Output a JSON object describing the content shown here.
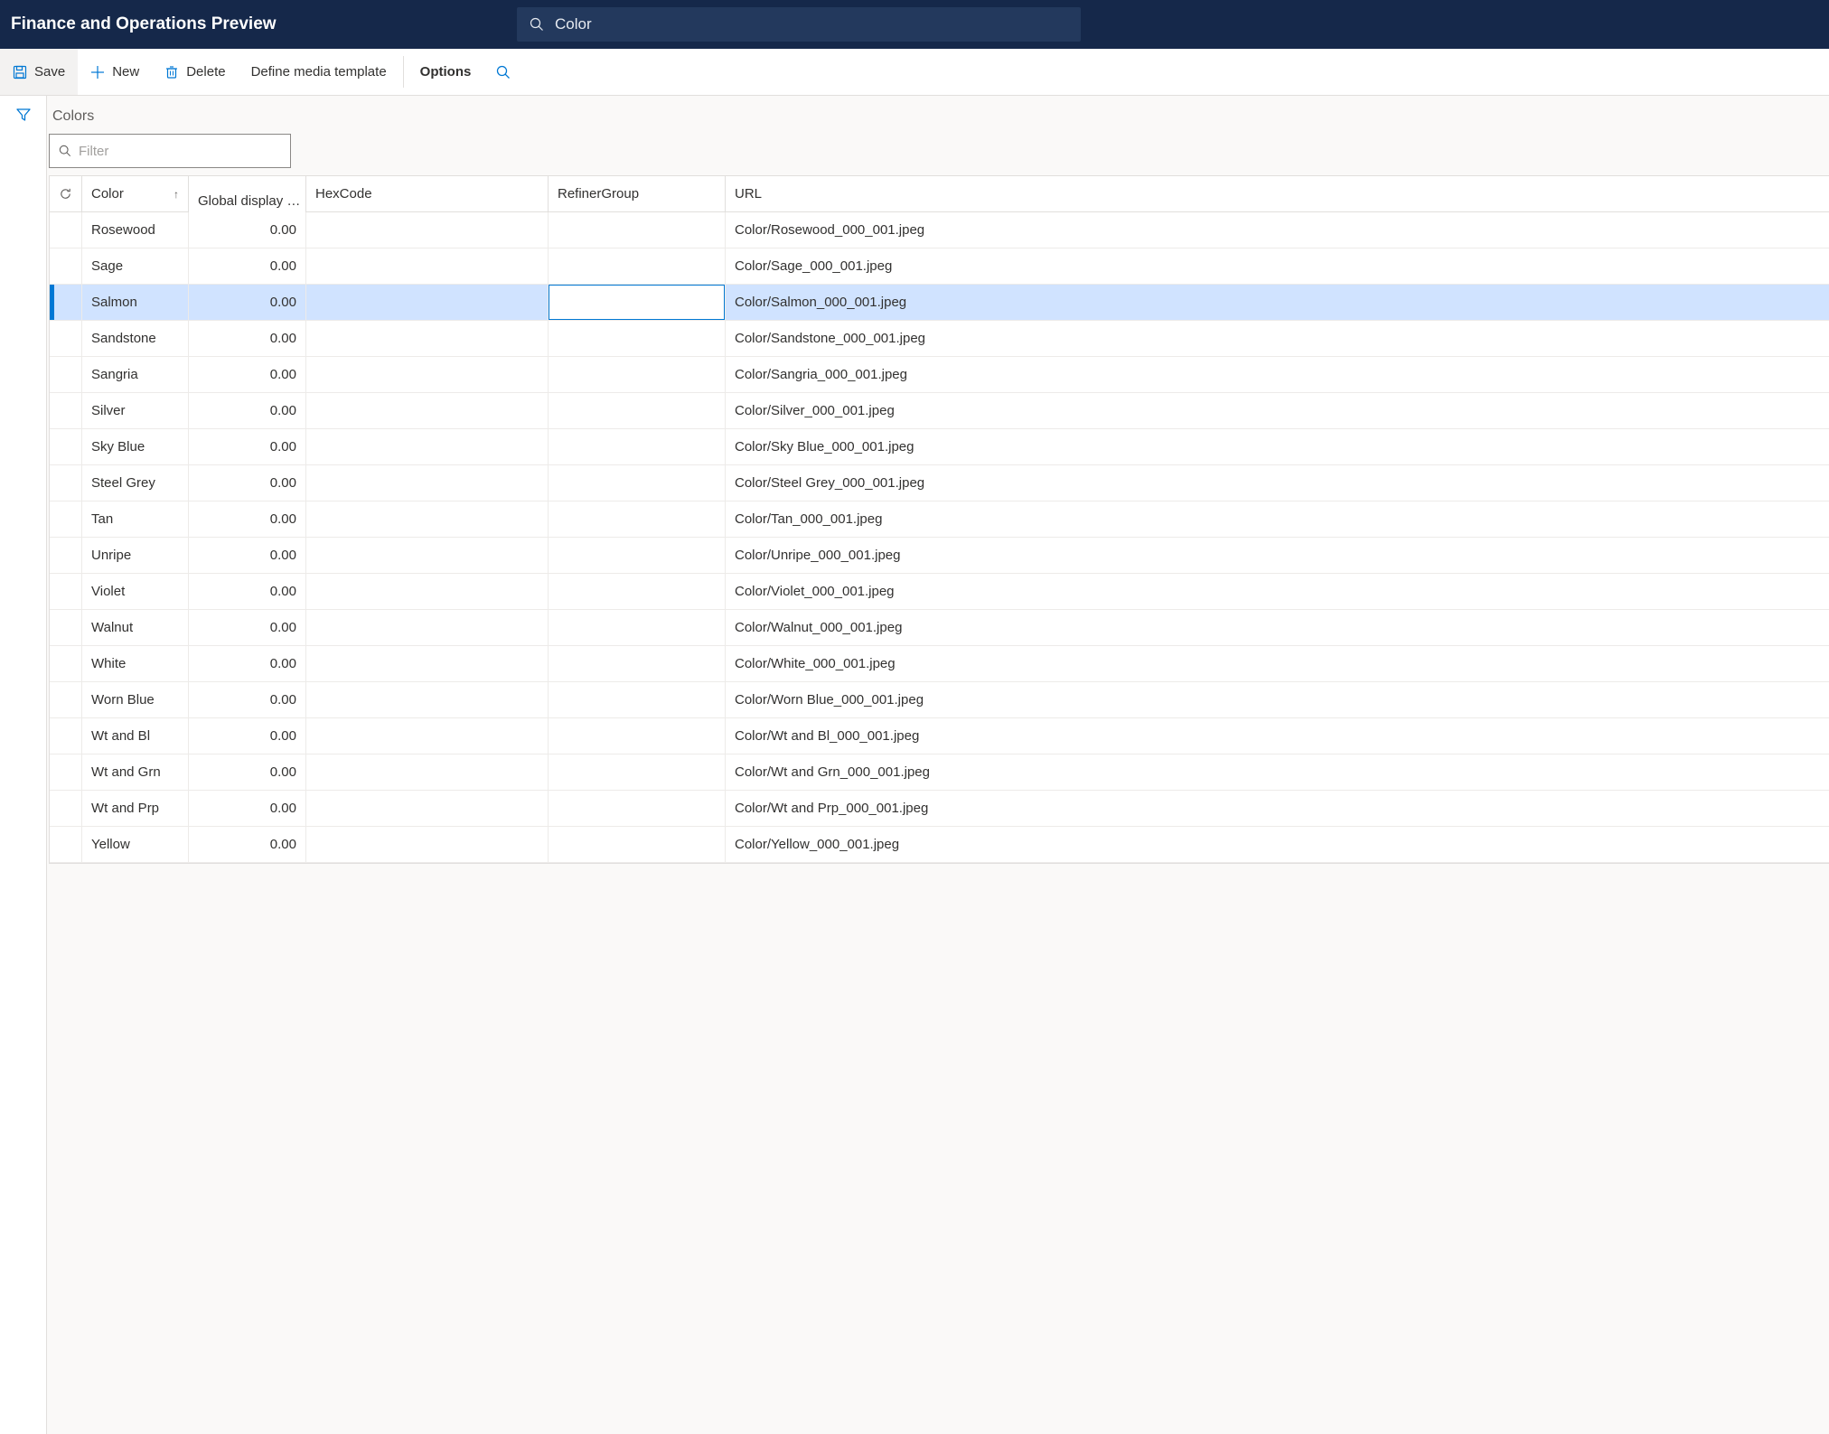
{
  "header": {
    "title": "Finance and Operations Preview",
    "search_value": "Color"
  },
  "toolbar": {
    "save": "Save",
    "new": "New",
    "delete": "Delete",
    "define_media": "Define media template",
    "options": "Options"
  },
  "section": {
    "title": "Colors",
    "filter_placeholder": "Filter"
  },
  "grid": {
    "columns": {
      "color": "Color",
      "display": "Global display …",
      "hex": "HexCode",
      "refiner": "RefinerGroup",
      "url": "URL"
    },
    "selected_index": 2,
    "rows": [
      {
        "color": "Rosewood",
        "display": "0.00",
        "hex": "",
        "refiner": "",
        "url": "Color/Rosewood_000_001.jpeg"
      },
      {
        "color": "Sage",
        "display": "0.00",
        "hex": "",
        "refiner": "",
        "url": "Color/Sage_000_001.jpeg"
      },
      {
        "color": "Salmon",
        "display": "0.00",
        "hex": "",
        "refiner": "",
        "url": "Color/Salmon_000_001.jpeg"
      },
      {
        "color": "Sandstone",
        "display": "0.00",
        "hex": "",
        "refiner": "",
        "url": "Color/Sandstone_000_001.jpeg"
      },
      {
        "color": "Sangria",
        "display": "0.00",
        "hex": "",
        "refiner": "",
        "url": "Color/Sangria_000_001.jpeg"
      },
      {
        "color": "Silver",
        "display": "0.00",
        "hex": "",
        "refiner": "",
        "url": "Color/Silver_000_001.jpeg"
      },
      {
        "color": "Sky Blue",
        "display": "0.00",
        "hex": "",
        "refiner": "",
        "url": "Color/Sky Blue_000_001.jpeg"
      },
      {
        "color": "Steel Grey",
        "display": "0.00",
        "hex": "",
        "refiner": "",
        "url": "Color/Steel Grey_000_001.jpeg"
      },
      {
        "color": "Tan",
        "display": "0.00",
        "hex": "",
        "refiner": "",
        "url": "Color/Tan_000_001.jpeg"
      },
      {
        "color": "Unripe",
        "display": "0.00",
        "hex": "",
        "refiner": "",
        "url": "Color/Unripe_000_001.jpeg"
      },
      {
        "color": "Violet",
        "display": "0.00",
        "hex": "",
        "refiner": "",
        "url": "Color/Violet_000_001.jpeg"
      },
      {
        "color": "Walnut",
        "display": "0.00",
        "hex": "",
        "refiner": "",
        "url": "Color/Walnut_000_001.jpeg"
      },
      {
        "color": "White",
        "display": "0.00",
        "hex": "",
        "refiner": "",
        "url": "Color/White_000_001.jpeg"
      },
      {
        "color": "Worn Blue",
        "display": "0.00",
        "hex": "",
        "refiner": "",
        "url": "Color/Worn Blue_000_001.jpeg"
      },
      {
        "color": "Wt and Bl",
        "display": "0.00",
        "hex": "",
        "refiner": "",
        "url": "Color/Wt and Bl_000_001.jpeg"
      },
      {
        "color": "Wt and Grn",
        "display": "0.00",
        "hex": "",
        "refiner": "",
        "url": "Color/Wt and Grn_000_001.jpeg"
      },
      {
        "color": "Wt and Prp",
        "display": "0.00",
        "hex": "",
        "refiner": "",
        "url": "Color/Wt and Prp_000_001.jpeg"
      },
      {
        "color": "Yellow",
        "display": "0.00",
        "hex": "",
        "refiner": "",
        "url": "Color/Yellow_000_001.jpeg"
      }
    ]
  }
}
